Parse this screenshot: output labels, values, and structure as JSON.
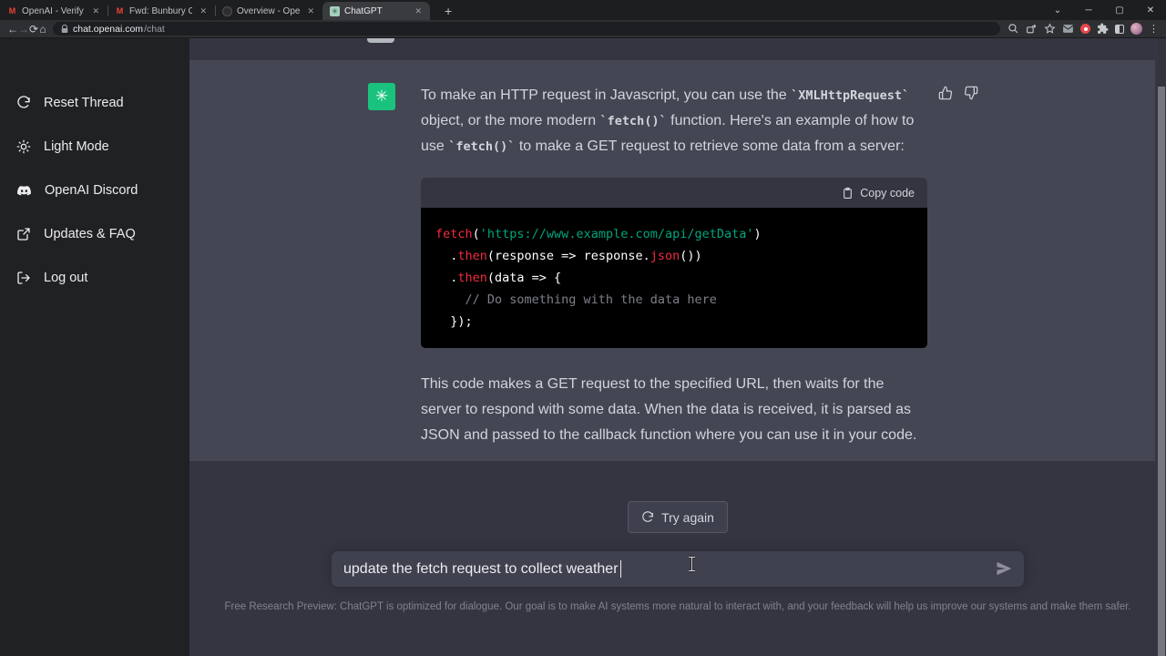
{
  "browser": {
    "tabs": [
      {
        "title": "OpenAI - Verify your email - rail",
        "favicon": "gmail-icon"
      },
      {
        "title": "Fwd: Bunbury Cleaning // Web C",
        "favicon": "gmail-icon"
      },
      {
        "title": "Overview - OpenAI API",
        "favicon": "openai-dark-icon"
      },
      {
        "title": "ChatGPT",
        "favicon": "chatgpt-icon"
      }
    ],
    "new_tab_label": "+",
    "close_label": "✕",
    "window_controls": {
      "hide": "⌄",
      "minimize": "─",
      "maximize": "▢",
      "close": "✕"
    },
    "nav": {
      "back": "←",
      "forward": "→",
      "reload": "⟳",
      "home": "⌂"
    },
    "address": {
      "host": "chat.openai.com",
      "path": "/chat"
    },
    "menu_dots": "⋮"
  },
  "sidebar": {
    "items": [
      {
        "label": "Reset Thread",
        "icon": "reset-icon"
      },
      {
        "label": "Light Mode",
        "icon": "sun-icon"
      },
      {
        "label": "OpenAI Discord",
        "icon": "discord-icon"
      },
      {
        "label": "Updates & FAQ",
        "icon": "external-link-icon"
      },
      {
        "label": "Log out",
        "icon": "logout-icon"
      }
    ]
  },
  "chat": {
    "assistant": {
      "avatar_glyph": "✳",
      "p1": {
        "s0": "To make an HTTP request in Javascript, you can use the ",
        "c0": "`XMLHttpRequest`",
        "s1": " object, or the more modern ",
        "c1": "`fetch()`",
        "s2": " function. Here's an example of how to use ",
        "c2": "`fetch()`",
        "s3": " to make a GET request to retrieve some data from a server:"
      },
      "code": {
        "copy_label": "Copy code",
        "l1": {
          "fn": "fetch",
          "p1": "(",
          "str": "'https://www.example.com/api/getData'",
          "p2": ")"
        },
        "l2": {
          "p1": "  .",
          "fn": "then",
          "p2": "(response => response.",
          "fn2": "json",
          "p3": "())"
        },
        "l3": {
          "p1": "  .",
          "fn": "then",
          "p2": "(data => {"
        },
        "l4": {
          "comment": "    // Do something with the data here"
        },
        "l5": {
          "p1": "  });"
        }
      },
      "p2": "This code makes a GET request to the specified URL, then waits for the server to respond with some data. When the data is received, it is parsed as JSON and passed to the callback function where you can use it in your code."
    },
    "try_again_label": "Try again",
    "composer_value": "update the fetch request to collect weather",
    "footer": "Free Research Preview: ChatGPT is optimized for dialogue. Our goal is to make AI systems more natural to interact with, and your feedback will help us improve our systems and make them safer."
  },
  "colors": {
    "assistant_avatar_green": "#19c37d",
    "code_function_red": "#f22c3d",
    "code_string_green": "#00a67d",
    "code_comment_gray": "#7d7f8a",
    "assistant_row_bg": "#444654",
    "main_bg": "#343541",
    "sidebar_bg": "#202123"
  },
  "icons": {
    "thumbs_up": "thumbs-up-icon",
    "thumbs_down": "thumbs-down-icon",
    "copy": "clipboard-icon",
    "send": "paper-plane-icon",
    "regenerate": "refresh-icon"
  }
}
